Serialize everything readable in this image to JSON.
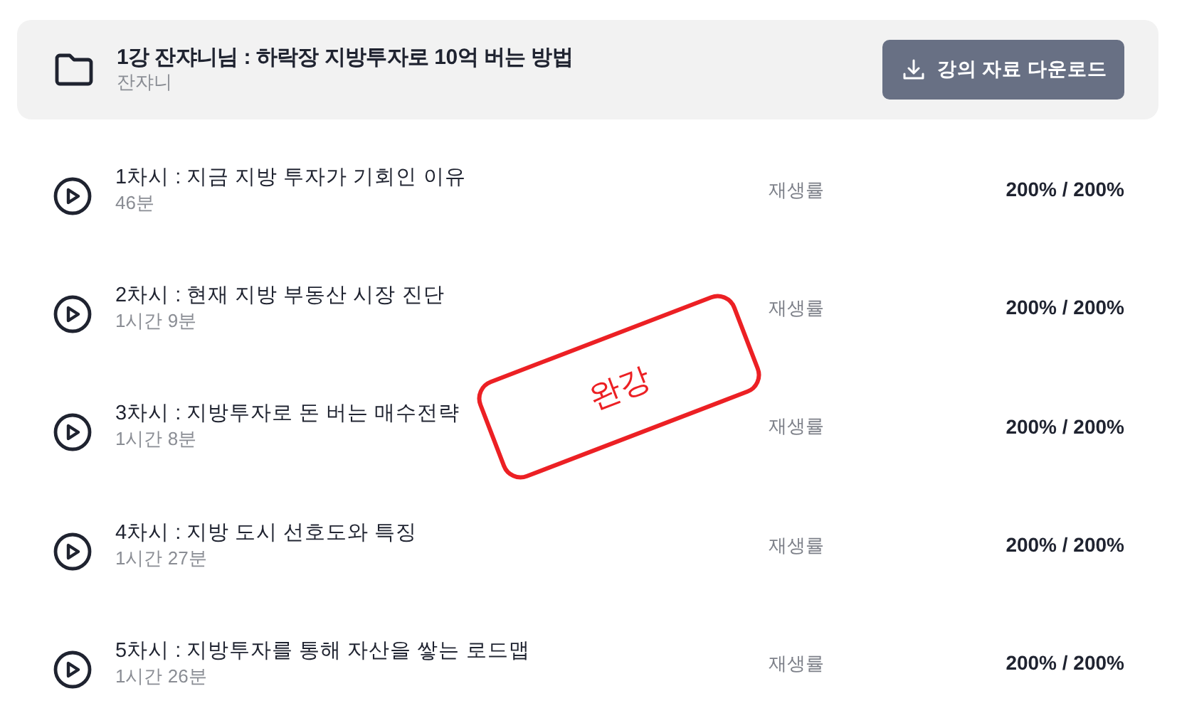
{
  "course": {
    "title": "1강 잔쟈니님 : 하락장 지방투자로 10억 버는 방법",
    "instructor": "잔쟈니",
    "download_button": "강의 자료 다운로드"
  },
  "lessons": [
    {
      "title": "1차시 : 지금 지방 투자가 기회인 이유",
      "duration": "46분",
      "progress_label": "재생률",
      "progress": "200% / 200%"
    },
    {
      "title": "2차시 : 현재 지방 부동산 시장 진단",
      "duration": "1시간 9분",
      "progress_label": "재생률",
      "progress": "200% / 200%"
    },
    {
      "title": "3차시 : 지방투자로 돈 버는 매수전략",
      "duration": "1시간 8분",
      "progress_label": "재생률",
      "progress": "200% / 200%"
    },
    {
      "title": "4차시 : 지방 도시 선호도와 특징",
      "duration": "1시간 27분",
      "progress_label": "재생률",
      "progress": "200% / 200%"
    },
    {
      "title": "5차시 : 지방투자를 통해 자산을 쌓는 로드맵",
      "duration": "1시간 26분",
      "progress_label": "재생률",
      "progress": "200% / 200%"
    }
  ],
  "stamp": {
    "text": "완강"
  }
}
